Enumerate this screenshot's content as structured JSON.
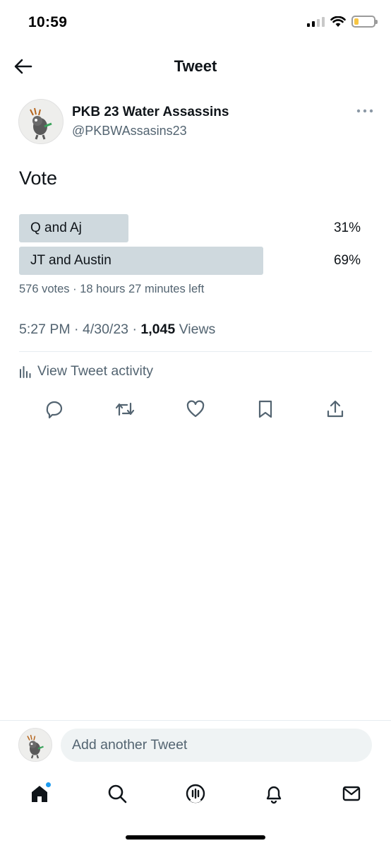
{
  "status_bar": {
    "time": "10:59",
    "icons": [
      "signal-icon",
      "wifi-icon",
      "battery-icon"
    ],
    "battery_level": 0.2,
    "battery_color": "#f6c543"
  },
  "header": {
    "title": "Tweet",
    "back_icon": "arrow-left-icon"
  },
  "tweet": {
    "author_name": "PKB 23 Water Assassins",
    "author_handle": "@PKBWAssasins23",
    "text": "Vote",
    "poll": {
      "options": [
        {
          "label": "Q and Aj",
          "percent_text": "31%",
          "percent": 31
        },
        {
          "label": "JT and Austin",
          "percent_text": "69%",
          "percent": 69
        }
      ],
      "meta": "576 votes · 18 hours 27 minutes left",
      "bar_color": "#cfd9de"
    },
    "time": "5:27 PM",
    "separator": "·",
    "date": "4/30/23",
    "views_count": "1,045",
    "views_label": "Views",
    "activity_label": "View Tweet activity",
    "actions": [
      "reply-icon",
      "retweet-icon",
      "like-icon",
      "bookmark-icon",
      "share-icon"
    ]
  },
  "reply_bar": {
    "placeholder": "Add another Tweet"
  },
  "tabbar": {
    "tabs": [
      "home-icon",
      "search-icon",
      "spaces-icon",
      "notifications-icon",
      "messages-icon"
    ],
    "notification_dot_color": "#1d9bf0"
  }
}
